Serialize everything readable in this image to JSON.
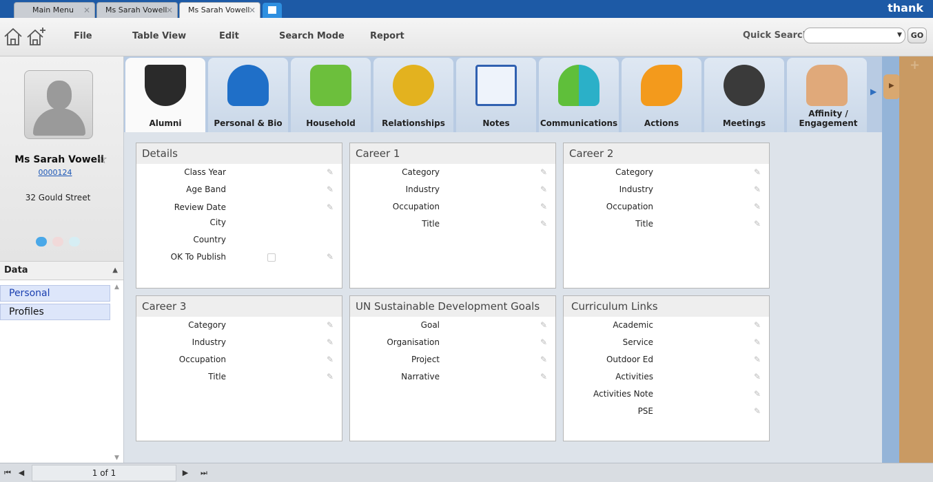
{
  "tabs": [
    {
      "label": "Main Menu"
    },
    {
      "label": "Ms Sarah Vowell"
    },
    {
      "label": "Ms Sarah Vowell"
    }
  ],
  "brand": "thank",
  "menu": {
    "file": "File",
    "table_view": "Table View",
    "edit": "Edit",
    "search_mode": "Search Mode",
    "report": "Report"
  },
  "quick_search": {
    "label": "Quick Search",
    "value": "",
    "go": "GO"
  },
  "contact": {
    "name": "Ms Sarah Vowell",
    "id": "0000124",
    "address": "32 Gould Street"
  },
  "sidebar": {
    "header": "Data",
    "items": [
      {
        "label": "Personal"
      },
      {
        "label": "Profiles"
      }
    ]
  },
  "tiles": [
    {
      "label": "Alumni"
    },
    {
      "label": "Personal & Bio"
    },
    {
      "label": "Household"
    },
    {
      "label": "Relationships"
    },
    {
      "label": "Notes"
    },
    {
      "label": "Communications"
    },
    {
      "label": "Actions"
    },
    {
      "label": "Meetings"
    },
    {
      "label": "Affinity / Engagement"
    }
  ],
  "panels": {
    "details": {
      "title": "Details",
      "fields": [
        "Class Year",
        "Age Band",
        "Review Date",
        "City",
        "Country",
        "OK To Publish"
      ]
    },
    "career1": {
      "title": "Career 1",
      "fields": [
        "Category",
        "Industry",
        "Occupation",
        "Title"
      ]
    },
    "career2": {
      "title": "Career 2",
      "fields": [
        "Category",
        "Industry",
        "Occupation",
        "Title"
      ]
    },
    "career3": {
      "title": "Career 3",
      "fields": [
        "Category",
        "Industry",
        "Occupation",
        "Title"
      ]
    },
    "sdg": {
      "title": "UN Sustainable Development Goals",
      "fields": [
        "Goal",
        "Organisation",
        "Project",
        "Narrative"
      ]
    },
    "curriculum": {
      "title": "Curriculum Links",
      "fields": [
        "Academic",
        "Service",
        "Outdoor Ed",
        "Activities",
        "Activities Note",
        "PSE"
      ]
    }
  },
  "pager": {
    "status": "1 of 1"
  },
  "colors": {
    "header_blue": "#1d5aa6",
    "link_blue": "#1a55b5",
    "tile_bg": "#c9d7e8",
    "cork": "#c99a63"
  }
}
